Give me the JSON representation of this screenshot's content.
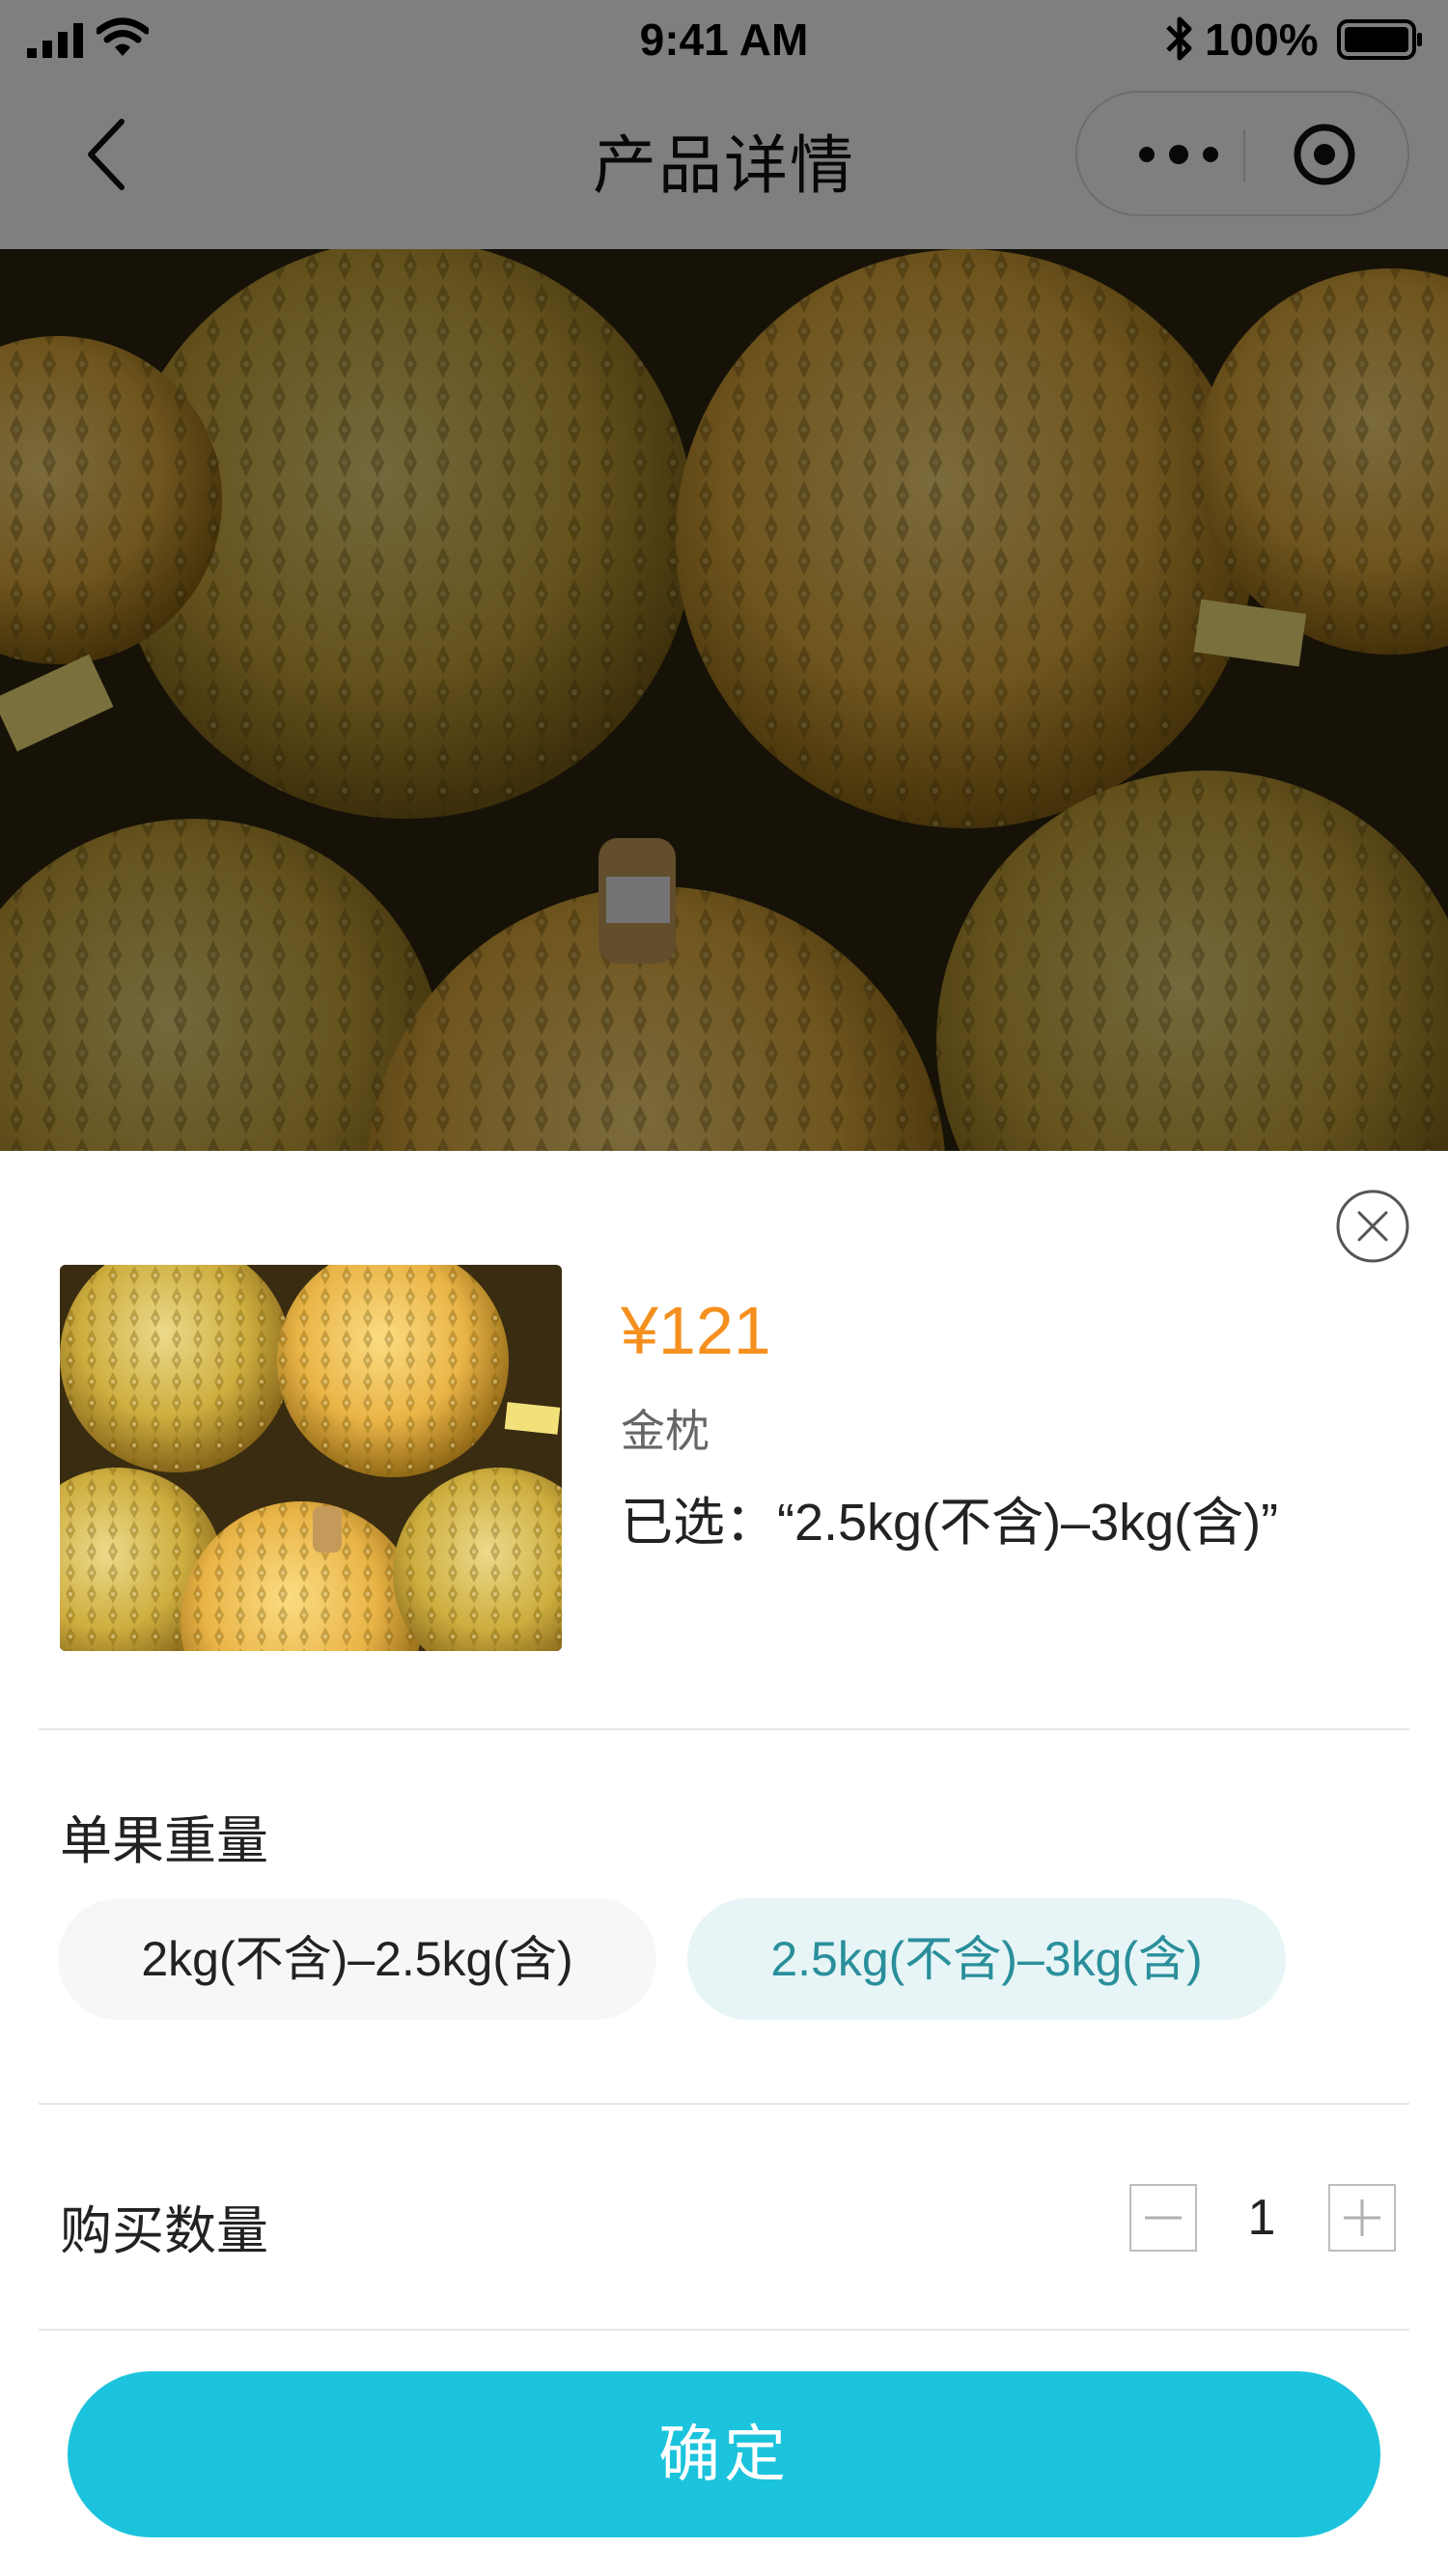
{
  "status_bar": {
    "time": "9:41 AM",
    "battery_text": "100%",
    "icons": [
      "signal-icon",
      "wifi-icon",
      "bluetooth-icon",
      "battery-icon"
    ]
  },
  "nav": {
    "title": "产品详情",
    "icons": [
      "back-icon",
      "more-icon",
      "capsule-close-icon"
    ]
  },
  "hero": {
    "image": "durian-photo"
  },
  "sheet": {
    "price": "¥121",
    "variety": "金枕",
    "selected_text": "已选：“2.5kg(不含)–3kg(含)”",
    "weight_label": "单果重量",
    "weight_options": [
      "2kg(不含)–2.5kg(含)",
      "2.5kg(不含)–3kg(含)"
    ],
    "selected_option_index": 1,
    "quantity_label": "购买数量",
    "quantity": "1",
    "confirm_label": "确定",
    "icons": [
      "close-circle-icon",
      "minus-icon",
      "plus-icon"
    ]
  },
  "colors": {
    "accent": "#1bc3dc",
    "price": "#f5901f",
    "chip_selected_bg": "#e7f5f6",
    "chip_selected_text": "#2a8f9b",
    "overlay": "rgba(0,0,0,0.5)"
  }
}
